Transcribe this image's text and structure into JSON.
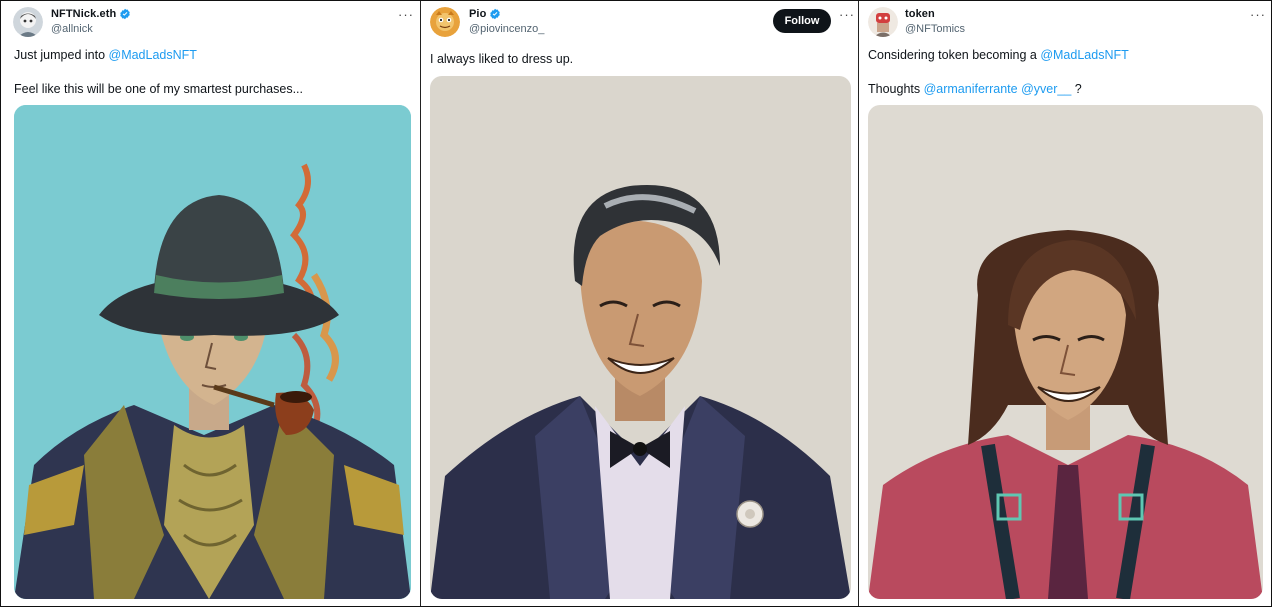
{
  "tweets": [
    {
      "name": "NFTNick.eth",
      "handle": "@allnick",
      "text_line1_prefix": "Just jumped into ",
      "text_line1_mention": "@MadLadsNFT",
      "text_line2": "Feel like this will be one of my smartest purchases...",
      "more": "···"
    },
    {
      "name": "Pio",
      "handle": "@piovincenzo_",
      "follow_label": "Follow",
      "text_line1": "I always liked to dress up.",
      "more": "···"
    },
    {
      "name": "token",
      "handle": "@NFTomics",
      "text_line1_prefix": "Considering token becoming a ",
      "text_line1_mention": "@MadLadsNFT",
      "text_line2_prefix": "Thoughts ",
      "text_line2_mention1": "@armaniferrante",
      "text_line2_mention2": "@yver__",
      "text_line2_suffix": " ?",
      "more": "···"
    }
  ],
  "colors": {
    "mention": "#1d9bf0",
    "verified": "#1d9bf0",
    "follow_bg": "#0f1419",
    "media1_bg": "#79c9cf",
    "media_bg_paper": "#dedad2"
  },
  "icons": [
    "verified-badge-icon",
    "more-options-icon"
  ]
}
